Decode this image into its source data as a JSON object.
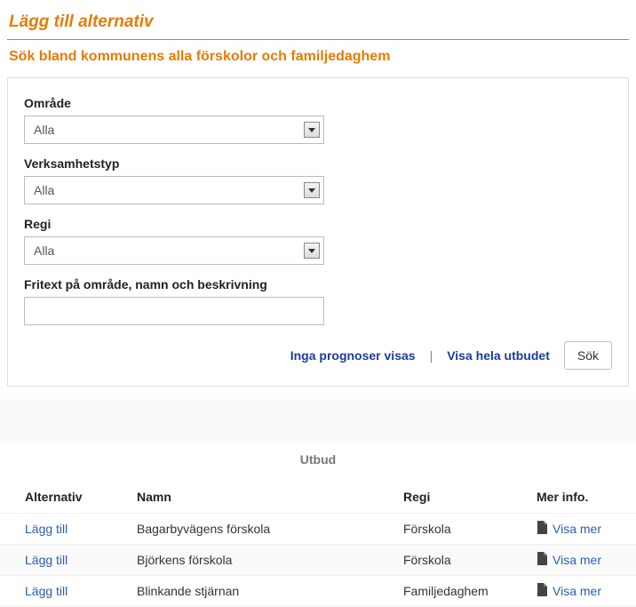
{
  "page_title": "Lägg till alternativ",
  "subtitle": "Sök bland kommunens alla förskolor och familjedaghem",
  "form": {
    "omrade": {
      "label": "Område",
      "value": "Alla"
    },
    "verksamhetstyp": {
      "label": "Verksamhetstyp",
      "value": "Alla"
    },
    "regi": {
      "label": "Regi",
      "value": "Alla"
    },
    "fritext": {
      "label": "Fritext på område, namn och beskrivning",
      "value": ""
    }
  },
  "actions": {
    "no_prognosis": "Inga prognoser visas",
    "show_all": "Visa hela utbudet",
    "search": "Sök"
  },
  "results_section_title": "Utbud",
  "table": {
    "headers": {
      "alternativ": "Alternativ",
      "namn": "Namn",
      "regi": "Regi",
      "mer": "Mer info."
    },
    "add_label": "Lägg till",
    "more_label": "Visa mer",
    "rows": [
      {
        "namn": "Bagarbyvägens förskola",
        "regi": "Förskola"
      },
      {
        "namn": "Björkens förskola",
        "regi": "Förskola"
      },
      {
        "namn": "Blinkande stjärnan",
        "regi": "Familjedaghem"
      }
    ]
  }
}
